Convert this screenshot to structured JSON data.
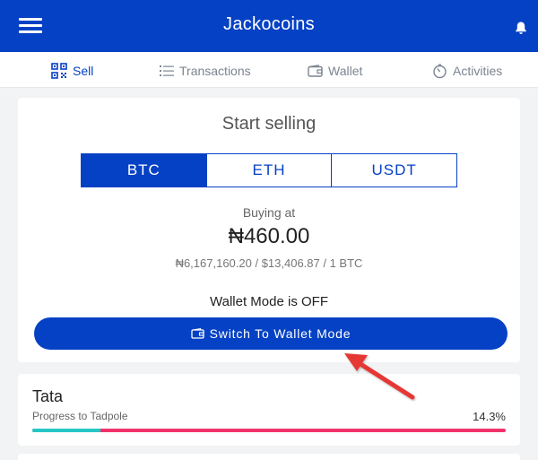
{
  "header": {
    "title": "Jackocoins"
  },
  "tabs": [
    {
      "label": "Sell",
      "icon": "qr-code-icon",
      "active": true
    },
    {
      "label": "Transactions",
      "icon": "list-icon",
      "active": false
    },
    {
      "label": "Wallet",
      "icon": "wallet-icon",
      "active": false
    },
    {
      "label": "Activities",
      "icon": "timer-icon",
      "active": false
    }
  ],
  "sell": {
    "title": "Start selling",
    "coins": [
      {
        "label": "BTC",
        "active": true
      },
      {
        "label": "ETH",
        "active": false
      },
      {
        "label": "USDT",
        "active": false
      }
    ],
    "buying_label": "Buying at",
    "price": "₦460.00",
    "rate": "₦6,167,160.20 / $13,406.87 / 1 BTC",
    "wallet_mode_status": "Wallet Mode is OFF",
    "switch_button": "Switch To Wallet Mode"
  },
  "progress": {
    "name": "Tata",
    "subtitle": "Progress to Tadpole",
    "percent_text": "14.3%",
    "fraction": 0.143
  },
  "colors": {
    "brand": "#0541c4",
    "progress_fill": "#26c6c6",
    "progress_track": "#f0336b",
    "annotation_arrow": "#e53935"
  }
}
